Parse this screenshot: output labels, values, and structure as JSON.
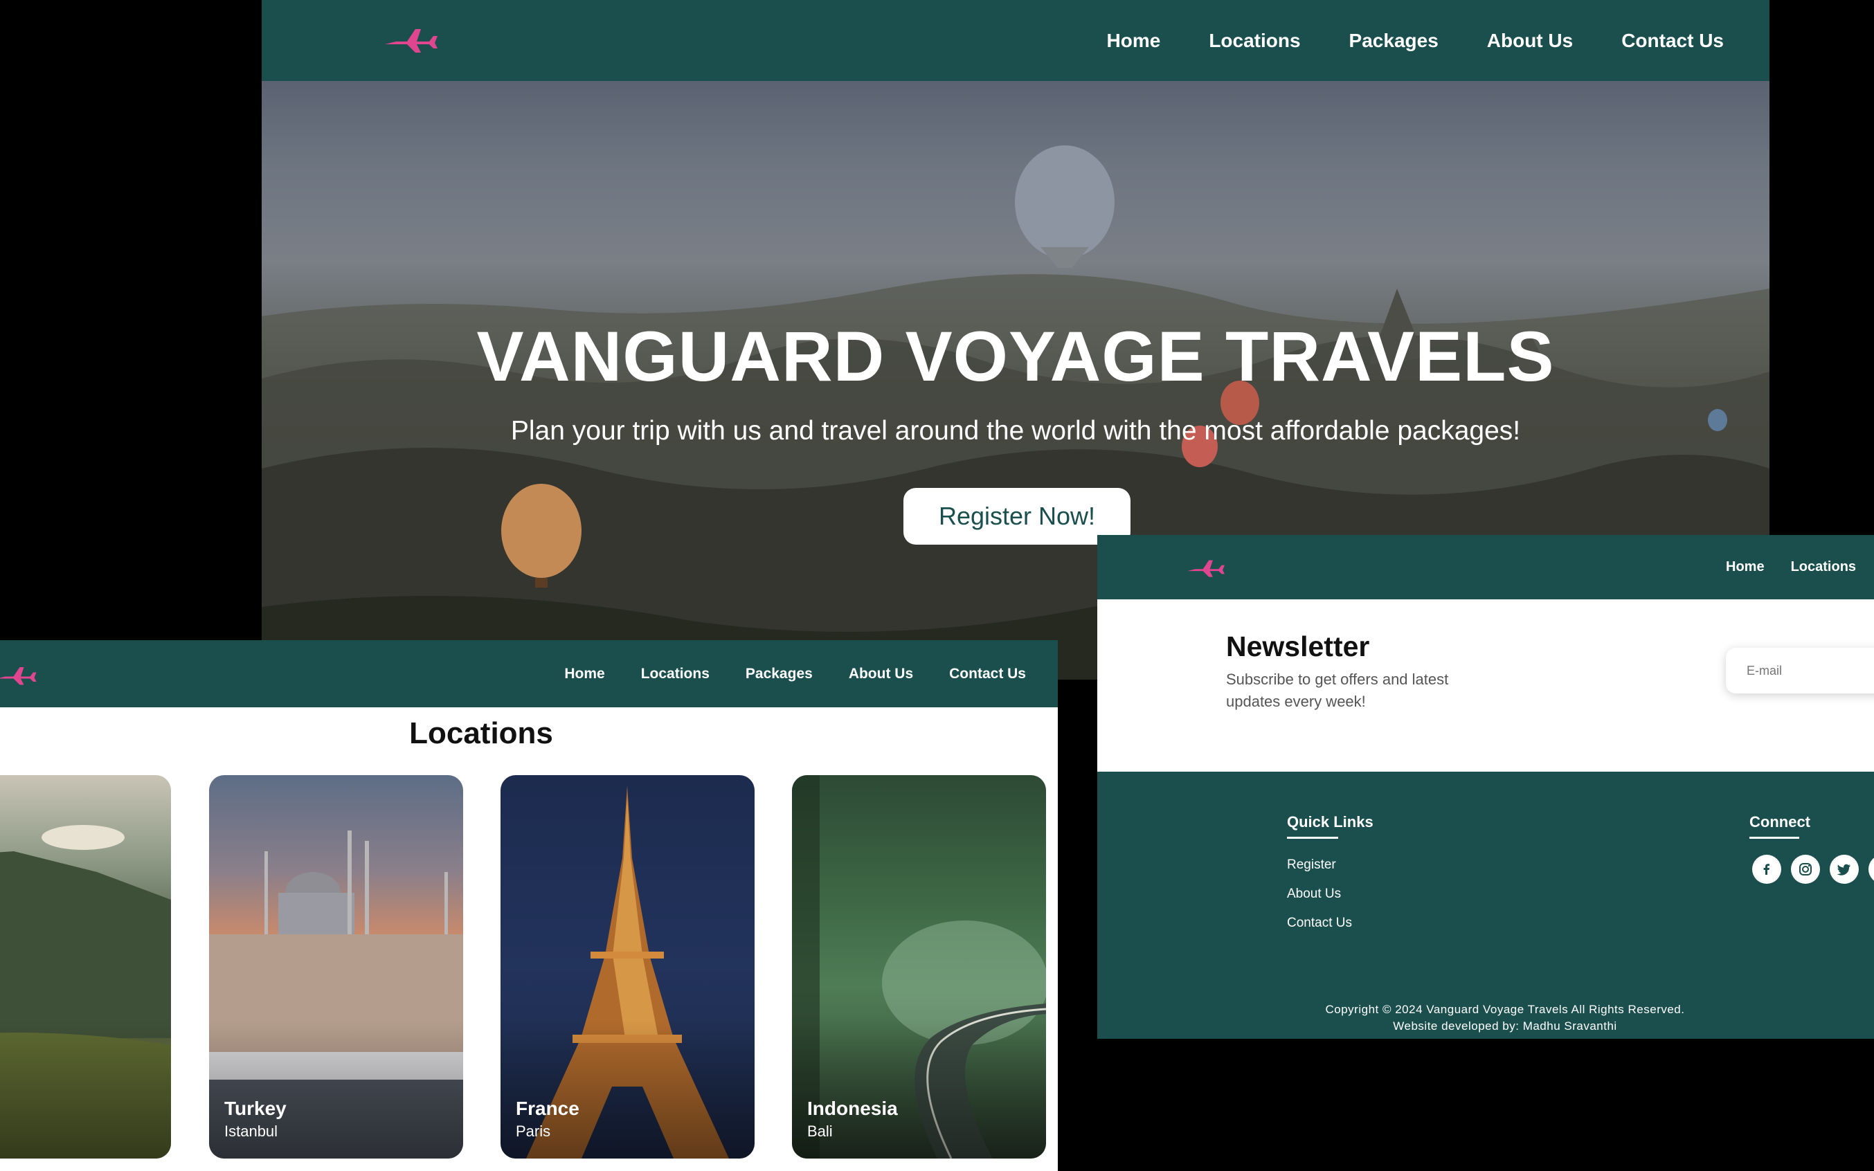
{
  "nav": {
    "home": "Home",
    "locations": "Locations",
    "packages": "Packages",
    "about": "About Us",
    "contact": "Contact Us"
  },
  "hero": {
    "title": "VANGUARD VOYAGE TRAVELS",
    "subtitle": "Plan your trip with us and travel around the world with the most affordable packages!",
    "cta": "Register Now!"
  },
  "locations": {
    "title": "Locations",
    "cards": [
      {
        "city": "",
        "place": "",
        "image": "mountain-meadow"
      },
      {
        "city": "Turkey",
        "place": "Istanbul",
        "image": "mosque-istanbul"
      },
      {
        "city": "France",
        "place": "Paris",
        "image": "eiffel-tower"
      },
      {
        "city": "Indonesia",
        "place": "Bali",
        "image": "forest-road"
      }
    ]
  },
  "newsletter": {
    "title": "Newsletter",
    "text": "Subscribe to get offers and latest updates every week!",
    "placeholder": "E-mail"
  },
  "footer": {
    "quick_links_title": "Quick Links",
    "links": [
      "Register",
      "About Us",
      "Contact Us"
    ],
    "connect_title": "Connect",
    "social": [
      "facebook-icon",
      "instagram-icon",
      "twitter-icon",
      "linkedin-icon"
    ],
    "copyright": "Copyright © 2024 Vanguard Voyage Travels All Rights Reserved.",
    "developer": "Website developed by: Madhu Sravanthi"
  },
  "colors": {
    "brand": "#1a4f4d",
    "logo": "#e0468f"
  }
}
